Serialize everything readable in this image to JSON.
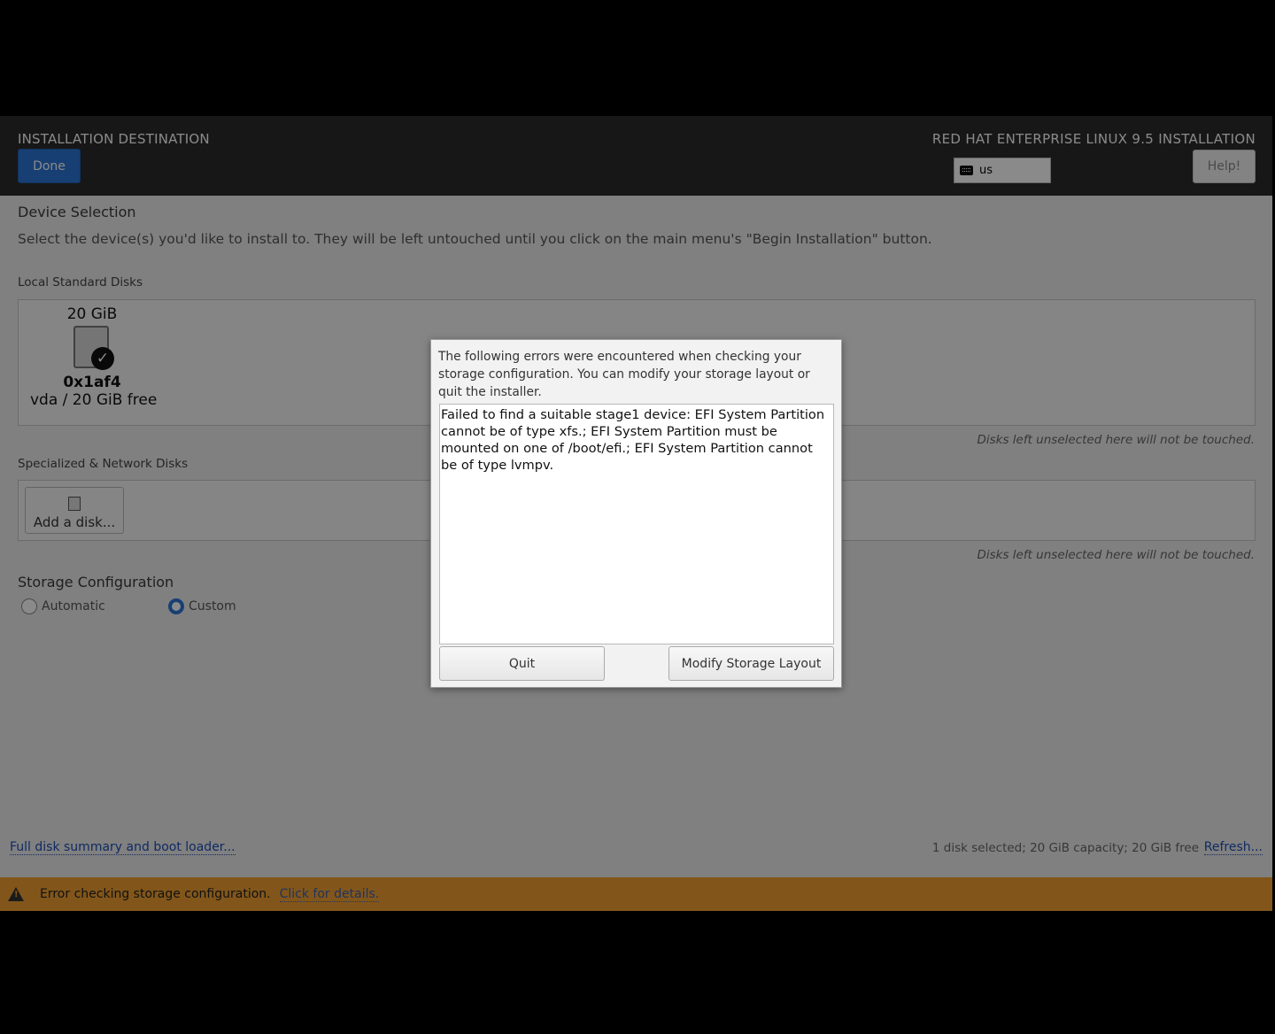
{
  "header": {
    "spoke_title": "INSTALLATION DESTINATION",
    "done_label": "Done",
    "product_title": "RED HAT ENTERPRISE LINUX 9.5 INSTALLATION",
    "keyboard_layout": "us",
    "help_label": "Help!"
  },
  "device_selection": {
    "title": "Device Selection",
    "description": "Select the device(s) you'd like to install to.  They will be left untouched until you click on the main menu's \"Begin Installation\" button."
  },
  "local_disks": {
    "label": "Local Standard Disks",
    "disks": [
      {
        "size": "20 GiB",
        "name": "0x1af4",
        "free": "vda  /  20 GiB free",
        "selected": true
      }
    ],
    "hint": "Disks left unselected here will not be touched."
  },
  "network_disks": {
    "label": "Specialized & Network Disks",
    "add_label": "Add a disk...",
    "hint": "Disks left unselected here will not be touched."
  },
  "storage_config": {
    "title": "Storage Configuration",
    "options": [
      {
        "label": "Automatic",
        "checked": false
      },
      {
        "label": "Custom",
        "checked": true
      }
    ]
  },
  "footer": {
    "summary_link": "Full disk summary and boot loader...",
    "selection_summary": "1 disk selected;  20 GiB capacity;  20 GiB free",
    "refresh_link": "Refresh..."
  },
  "status_bar": {
    "message": "Error checking storage configuration.",
    "link": "Click for details.",
    "color": "#f0a030"
  },
  "dialog": {
    "message": "The following errors were encountered when checking your storage configuration.  You can modify your storage layout or quit the installer.",
    "details": "Failed to find a suitable stage1 device: EFI System Partition cannot be of type xfs.; EFI System Partition must be mounted on one of /boot/efi.; EFI System Partition cannot be of type lvmpv.",
    "quit_label": "Quit",
    "modify_label": "Modify Storage Layout"
  },
  "colors": {
    "accent": "#2d75d6",
    "header_bg": "#2b2b2b",
    "link": "#1e4fb4"
  }
}
